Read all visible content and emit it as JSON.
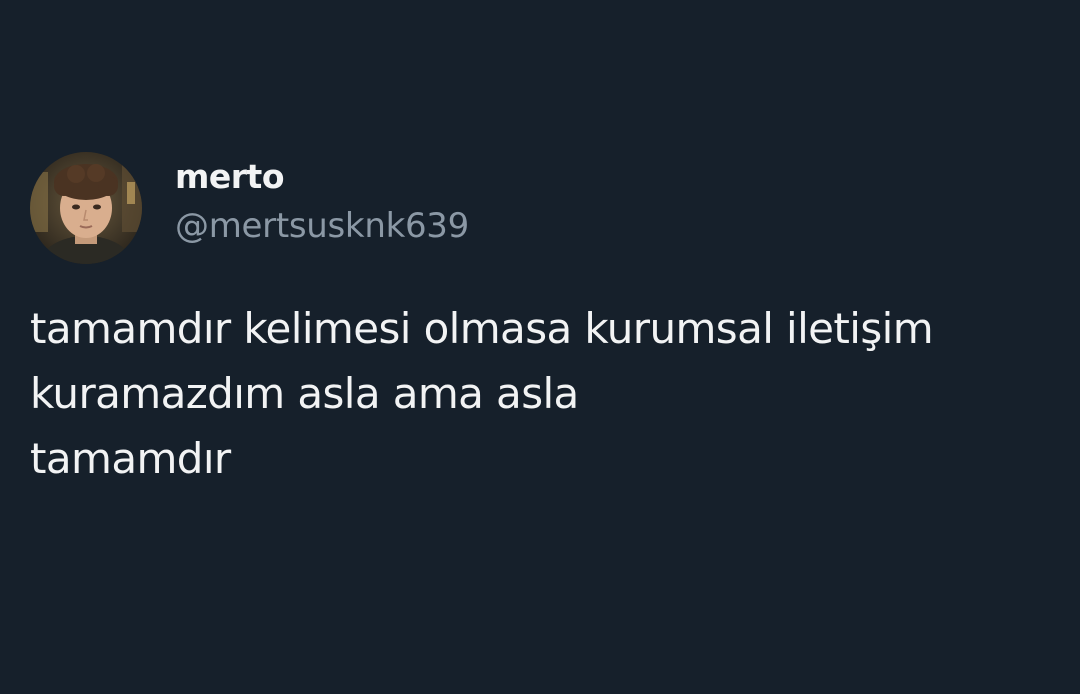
{
  "tweet": {
    "author": {
      "display_name": "merto",
      "handle": "@mertsusknk639",
      "avatar_icon": "profile-photo-avatar"
    },
    "text_lines": [
      "tamamdır kelimesi olmasa kurumsal iletişim",
      "kuramazdım asla ama asla",
      "tamamdır"
    ]
  },
  "colors": {
    "background": "#16202b",
    "primary_text": "#f2f3f4",
    "secondary_text": "#8b98a5"
  }
}
